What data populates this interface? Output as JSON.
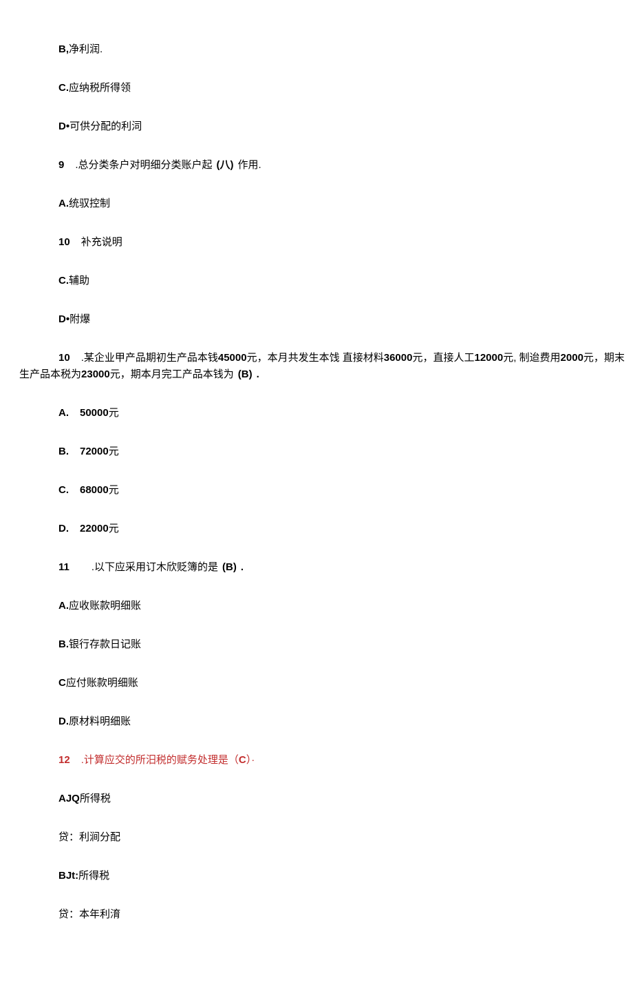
{
  "lines": {
    "l1a": "B,",
    "l1b": "净利润.",
    "l2a": "C.",
    "l2b": "应纳税所得领",
    "l3a": "D•",
    "l3b": "可供分配的利泀",
    "l4a": "9",
    "l4b": ".总分类条户对明细分类账户起",
    "l4c": "(八)",
    "l4d": "作用.",
    "l5a": "A.",
    "l5b": "统驭控制",
    "l6a": "10",
    "l6b": "补充说明",
    "l7a": "C.",
    "l7b": "辅助",
    "l8a": "D•",
    "l8b": "附爆",
    "l9a": "10",
    "l9b": ".某企业甲产品期初生产品本钱",
    "l9c": "45000",
    "l9d": "元，本月共发生本饯 直接材料",
    "l9e": "36000",
    "l9f": "元，直接人工",
    "l9g": "12000",
    "l9h": "元, 制迨费用",
    "l9i": "2000",
    "l9j": "元，期末生产品本税为",
    "l9k": "23000",
    "l9l": "元，期本月完工产品本钱为",
    "l9m": "(B)",
    "l9n": ".",
    "l10a": "A.",
    "l10b": "50000",
    "l10c": "元",
    "l11a": "B.",
    "l11b": "72000",
    "l11c": "元",
    "l12a": "C.",
    "l12b": "68000",
    "l12c": "元",
    "l13a": "D.",
    "l13b": "22000",
    "l13c": "元",
    "l14a": "11",
    "l14b": ".以下应采用订木欣贬簿的是",
    "l14c": "(B)",
    "l14d": ".",
    "l15a": "A.",
    "l15b": "应收账款明细账",
    "l16a": "B.",
    "l16b": "银行存款日记账",
    "l17a": "C",
    "l17b": "应付账款明细账",
    "l18a": "D.",
    "l18b": "原材料明细账",
    "l19a": "12",
    "l19b": ".计算应交的所汨税的赋务处理是（",
    "l19c": "C",
    "l19d": "）·",
    "l20a": "AJQ",
    "l20b": "所得税",
    "l21": "贷：利涧分配",
    "l22a": "BJt:",
    "l22b": "所得税",
    "l23": "贷：本年利淯"
  }
}
